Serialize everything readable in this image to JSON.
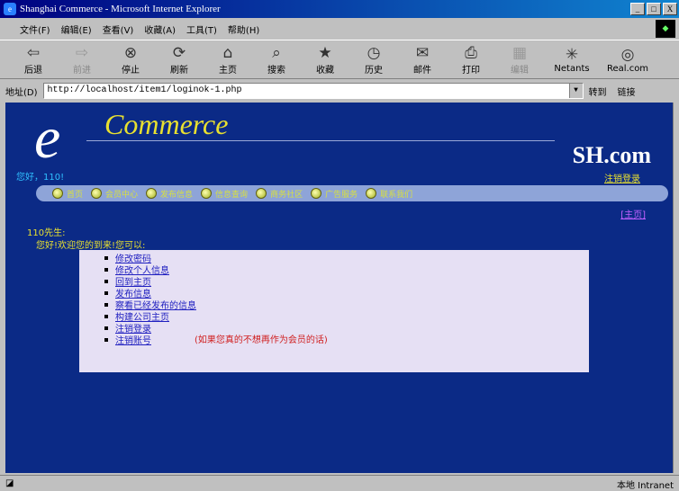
{
  "window": {
    "title": "Shanghai Commerce - Microsoft Internet Explorer",
    "ie_badge": "e",
    "controls": [
      "_",
      "□",
      "X"
    ]
  },
  "menu": [
    "文件(F)",
    "编辑(E)",
    "查看(V)",
    "收藏(A)",
    "工具(T)",
    "帮助(H)"
  ],
  "toolbar": {
    "buttons": [
      {
        "label": "后退",
        "icon": "back-arrow-icon",
        "glyph": "⇦",
        "enabled": true
      },
      {
        "label": "前进",
        "icon": "forward-arrow-icon",
        "glyph": "⇨",
        "enabled": false
      },
      {
        "label": "停止",
        "icon": "stop-icon",
        "glyph": "⊗",
        "enabled": true
      },
      {
        "label": "刷新",
        "icon": "refresh-icon",
        "glyph": "⟳",
        "enabled": true
      },
      {
        "label": "主页",
        "icon": "home-icon",
        "glyph": "⌂",
        "enabled": true
      },
      {
        "label": "搜索",
        "icon": "search-icon",
        "glyph": "⌕",
        "enabled": true
      },
      {
        "label": "收藏",
        "icon": "favorites-icon",
        "glyph": "★",
        "enabled": true
      },
      {
        "label": "历史",
        "icon": "history-icon",
        "glyph": "◷",
        "enabled": true
      },
      {
        "label": "邮件",
        "icon": "mail-icon",
        "glyph": "✉",
        "enabled": true
      },
      {
        "label": "打印",
        "icon": "print-icon",
        "glyph": "⎙",
        "enabled": true
      },
      {
        "label": "编辑",
        "icon": "edit-icon",
        "glyph": "▦",
        "enabled": false
      },
      {
        "label": "Netants",
        "icon": "netants-icon",
        "glyph": "✳",
        "enabled": true
      },
      {
        "label": "Real.com",
        "icon": "real-icon",
        "glyph": "◎",
        "enabled": true
      }
    ]
  },
  "address": {
    "label": "地址(D)",
    "value": "http://localhost/item1/loginok-1.php",
    "go": "转到",
    "links": "链接"
  },
  "status": {
    "left": "",
    "zone": "本地 Intranet"
  },
  "page": {
    "logo_e": "e",
    "logo_commerce": "Commerce",
    "logo_sh": "SH.com",
    "greeting": "您好，110!",
    "logout_top": "注销登录",
    "nav": [
      "首页",
      "会员中心",
      "发布信息",
      "信息查询",
      "商务社区",
      "广告服务",
      "联系我们"
    ],
    "main_link": "[主页]",
    "user_name": "110先生:",
    "welcome": "您好!欢迎您的到来!您可以:",
    "actions": [
      "修改密码",
      "修改个人信息",
      "回到主页",
      "发布信息",
      "察看已经发布的信息",
      "构建公司主页",
      "注销登录",
      "注销账号"
    ],
    "note": "(如果您真的不想再作为会员的话)"
  }
}
